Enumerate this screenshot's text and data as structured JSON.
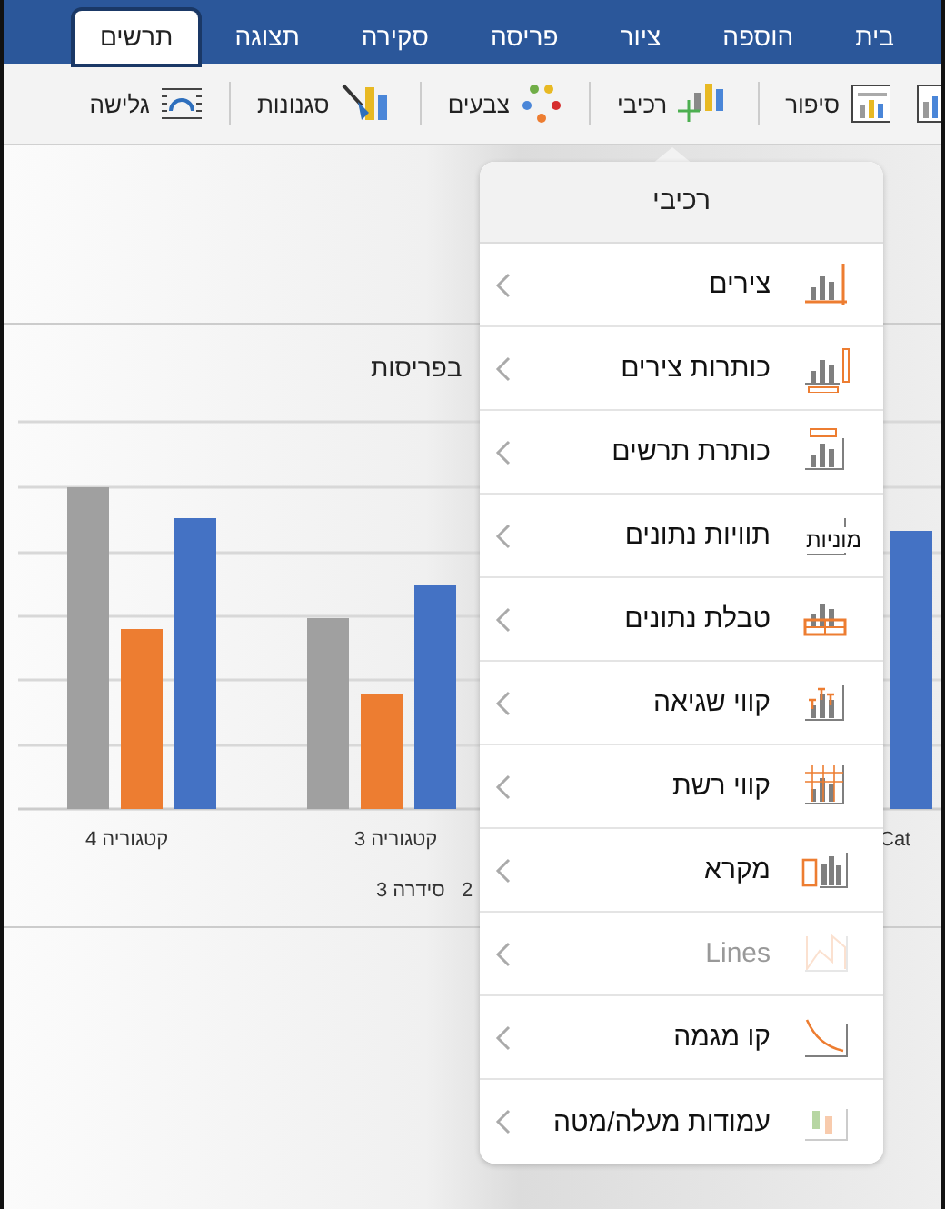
{
  "tabs": [
    {
      "label": "בית",
      "selected": false
    },
    {
      "label": "הוספה",
      "selected": false
    },
    {
      "label": "ציור",
      "selected": false
    },
    {
      "label": "פריסה",
      "selected": false
    },
    {
      "label": "סקירה",
      "selected": false
    },
    {
      "label": "תצוגה",
      "selected": false
    },
    {
      "label": "תרשים",
      "selected": true
    }
  ],
  "ribbon": [
    {
      "label": "סיפור",
      "kind": "layout"
    },
    {
      "label": "רכיבי",
      "kind": "elements"
    },
    {
      "label": "צבעים",
      "kind": "colors"
    },
    {
      "label": "סגנונות",
      "kind": "styles"
    },
    {
      "label": "גלישה",
      "kind": "wrap"
    }
  ],
  "chart": {
    "title": "בפריסות",
    "categories": [
      "Cat",
      "קטגוריה 3",
      "קטגוריה 4"
    ],
    "legend": [
      "2",
      "סידרה 3"
    ]
  },
  "popover": {
    "title": "רכיבי",
    "items": [
      {
        "label": "צירים",
        "kind": "axes",
        "disabled": false
      },
      {
        "label": "כותרות צירים",
        "kind": "axis-titles",
        "disabled": false
      },
      {
        "label": "כותרת תרשים",
        "kind": "chart-title",
        "disabled": false
      },
      {
        "label": "תוויות נתונים",
        "kind": "data-labels",
        "disabled": false,
        "icon_text": "מוניות"
      },
      {
        "label": "טבלת נתונים",
        "kind": "data-table",
        "disabled": false
      },
      {
        "label": "קווי שגיאה",
        "kind": "error-bars",
        "disabled": false
      },
      {
        "label": "קווי רשת",
        "kind": "gridlines",
        "disabled": false
      },
      {
        "label": "מקרא",
        "kind": "legend",
        "disabled": false
      },
      {
        "label": "Lines",
        "kind": "lines",
        "disabled": true
      },
      {
        "label": "קו מגמה",
        "kind": "trendline",
        "disabled": false
      },
      {
        "label": "עמודות מעלה/מטה",
        "kind": "up-down-bars",
        "disabled": false
      }
    ]
  }
}
